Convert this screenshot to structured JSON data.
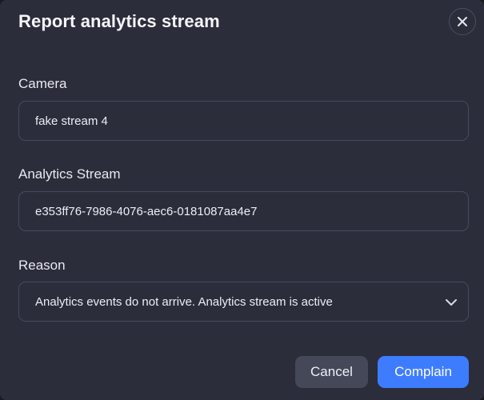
{
  "dialog": {
    "title": "Report analytics stream",
    "close_icon": "close-icon"
  },
  "form": {
    "camera": {
      "label": "Camera",
      "value": "fake stream 4"
    },
    "analytics_stream": {
      "label": "Analytics Stream",
      "value": "e353ff76-7986-4076-aec6-0181087aa4e7"
    },
    "reason": {
      "label": "Reason",
      "selected": "Analytics events do not arrive. Analytics stream is active",
      "icon": "chevron-down-icon"
    }
  },
  "actions": {
    "cancel_label": "Cancel",
    "complain_label": "Complain"
  },
  "colors": {
    "background": "#2b2d3b",
    "border": "#474a5c",
    "primary": "#3e7cff",
    "secondary_button": "#454859"
  }
}
